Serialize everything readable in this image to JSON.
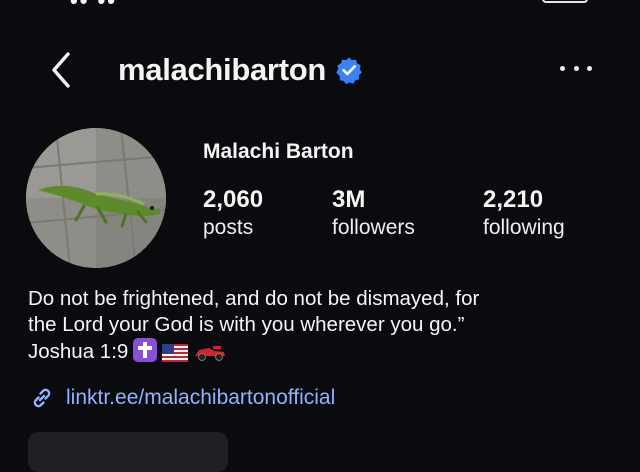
{
  "header": {
    "username": "malachibarton",
    "verified": true
  },
  "profile": {
    "full_name": "Malachi Barton",
    "stats": [
      {
        "value": "2,060",
        "label": "posts"
      },
      {
        "value": "3M",
        "label": "followers"
      },
      {
        "value": "2,210",
        "label": "following"
      }
    ],
    "bio_lines": [
      "Do not be frightened, and do not be dismayed, for",
      "the Lord your God is with you wherever you go.”",
      "Joshua 1:9"
    ],
    "bio_emoji_icons": [
      "latin-cross-emoji-icon",
      "us-flag-emoji-icon",
      "race-car-emoji-icon"
    ],
    "link": "linktr.ee/malachibartonofficial"
  },
  "colors": {
    "background": "#0a0b0f",
    "link": "#8fb3ff",
    "verified": "#3b82f6"
  }
}
